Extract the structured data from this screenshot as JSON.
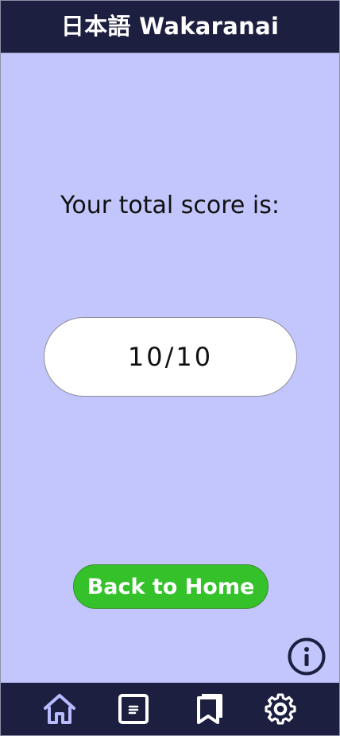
{
  "header": {
    "title": "日本語 Wakaranai"
  },
  "result": {
    "label": "Your total score is:",
    "score": "10/10"
  },
  "actions": {
    "home_button": "Back to Home"
  },
  "icons": {
    "info": "info-icon",
    "nav": [
      "home-icon",
      "page-icon",
      "bookmark-icon",
      "gear-icon"
    ]
  },
  "colors": {
    "background": "#c3c6fc",
    "header": "#1c1f3f",
    "accent": "#34c12a",
    "active_nav": "#b9bbff"
  }
}
